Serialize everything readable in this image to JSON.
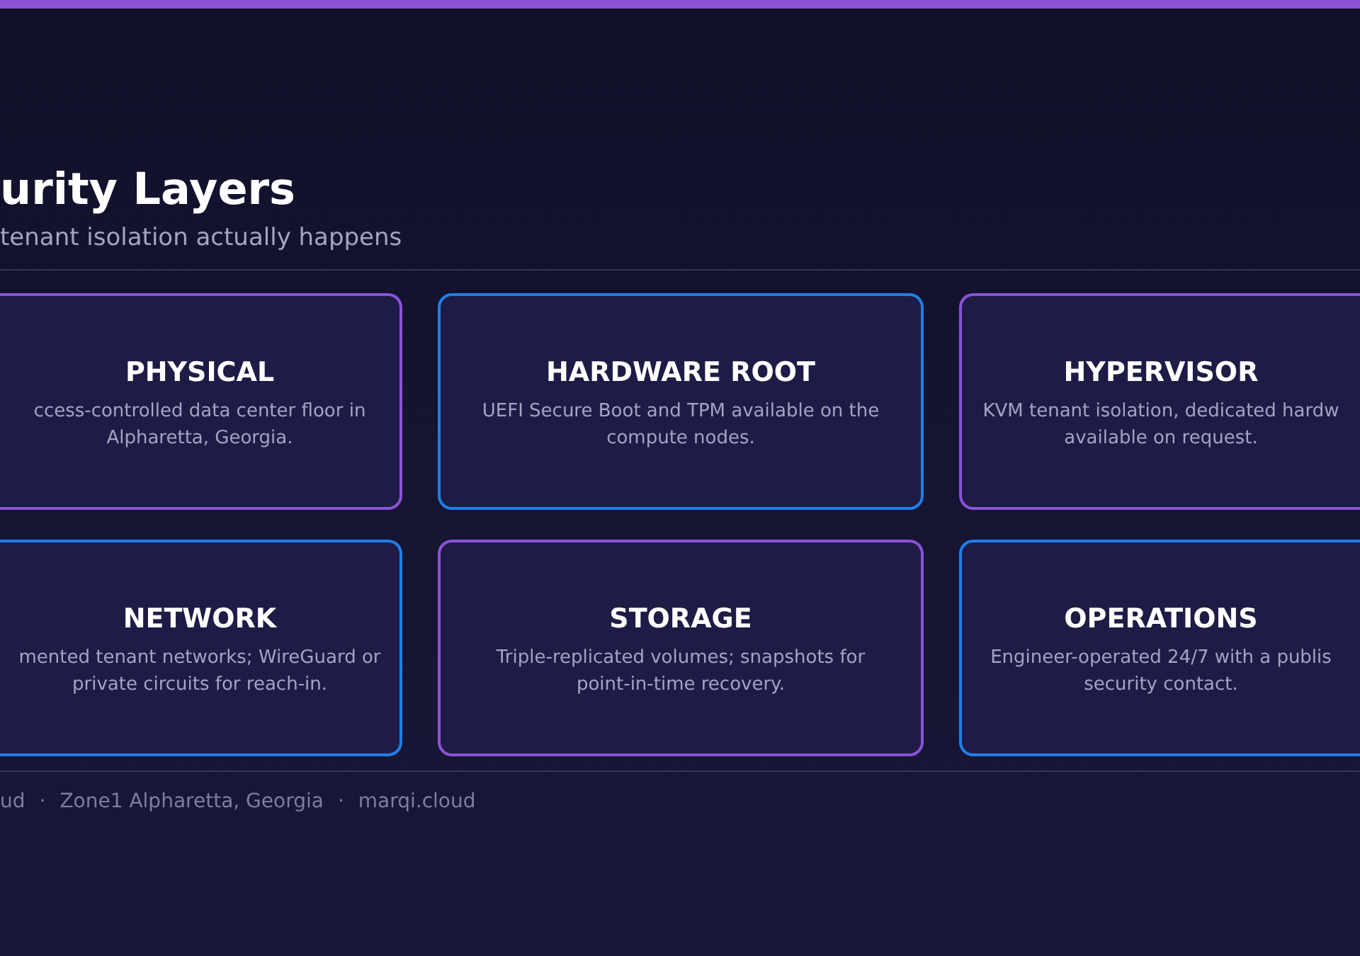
{
  "header": {
    "title": "urity Layers",
    "subtitle": "tenant isolation actually happens"
  },
  "cards": [
    {
      "title": "PHYSICAL",
      "description": "ccess-controlled data center floor in\nAlpharetta, Georgia.",
      "color": "#8b52d6"
    },
    {
      "title": "HARDWARE ROOT",
      "description": "UEFI Secure Boot and TPM available on the\ncompute nodes.",
      "color": "#1f7fe6"
    },
    {
      "title": "HYPERVISOR",
      "description": "KVM tenant isolation, dedicated hardw\navailable on request.",
      "color": "#8b52d6"
    },
    {
      "title": "NETWORK",
      "description": "mented tenant networks; WireGuard or\nprivate circuits for reach-in.",
      "color": "#1f7fe6"
    },
    {
      "title": "STORAGE",
      "description": "Triple-replicated volumes; snapshots for\npoint-in-time recovery.",
      "color": "#8b52d6"
    },
    {
      "title": "OPERATIONS",
      "description": "Engineer-operated 24/7 with a publis\nsecurity contact.",
      "color": "#1f7fe6"
    }
  ],
  "footer": [
    "ud",
    "·",
    "Zone1 Alpharetta, Georgia",
    "·",
    "marqi.cloud"
  ]
}
